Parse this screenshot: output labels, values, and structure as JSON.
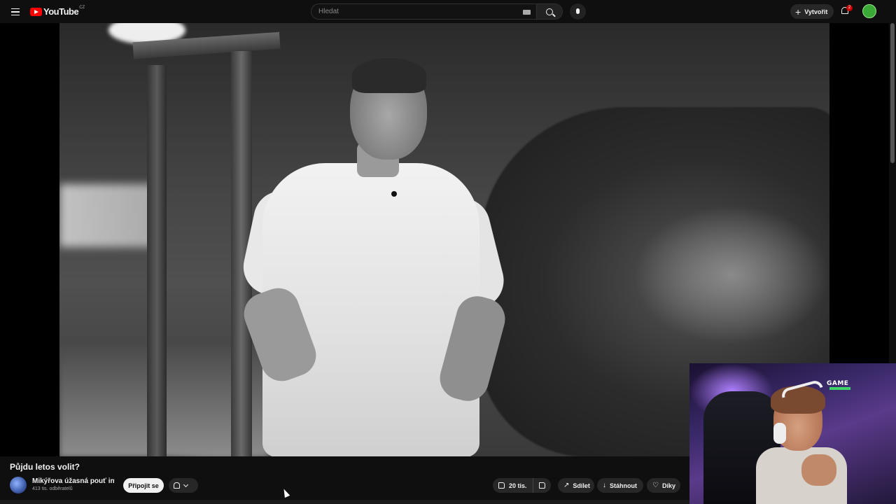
{
  "header": {
    "logo_text": "YouTube",
    "region": "CZ",
    "search_placeholder": "Hledat",
    "create_label": "Vytvořit",
    "notification_count": "2"
  },
  "video": {
    "title": "Půjdu letos volit?",
    "overlay_brand": "GAME"
  },
  "channel": {
    "name": "Mikýřova úžasná pouť int...",
    "subscribers": "413 tis. odběratelů",
    "join_label": "Připojit se"
  },
  "actions": {
    "likes": "20 tis.",
    "share_label": "Sdílet",
    "download_label": "Stáhnout",
    "thanks_label": "Díky"
  },
  "colors": {
    "background": "#0f0f0f",
    "accent": "#ff0000",
    "pill": "#272727"
  }
}
